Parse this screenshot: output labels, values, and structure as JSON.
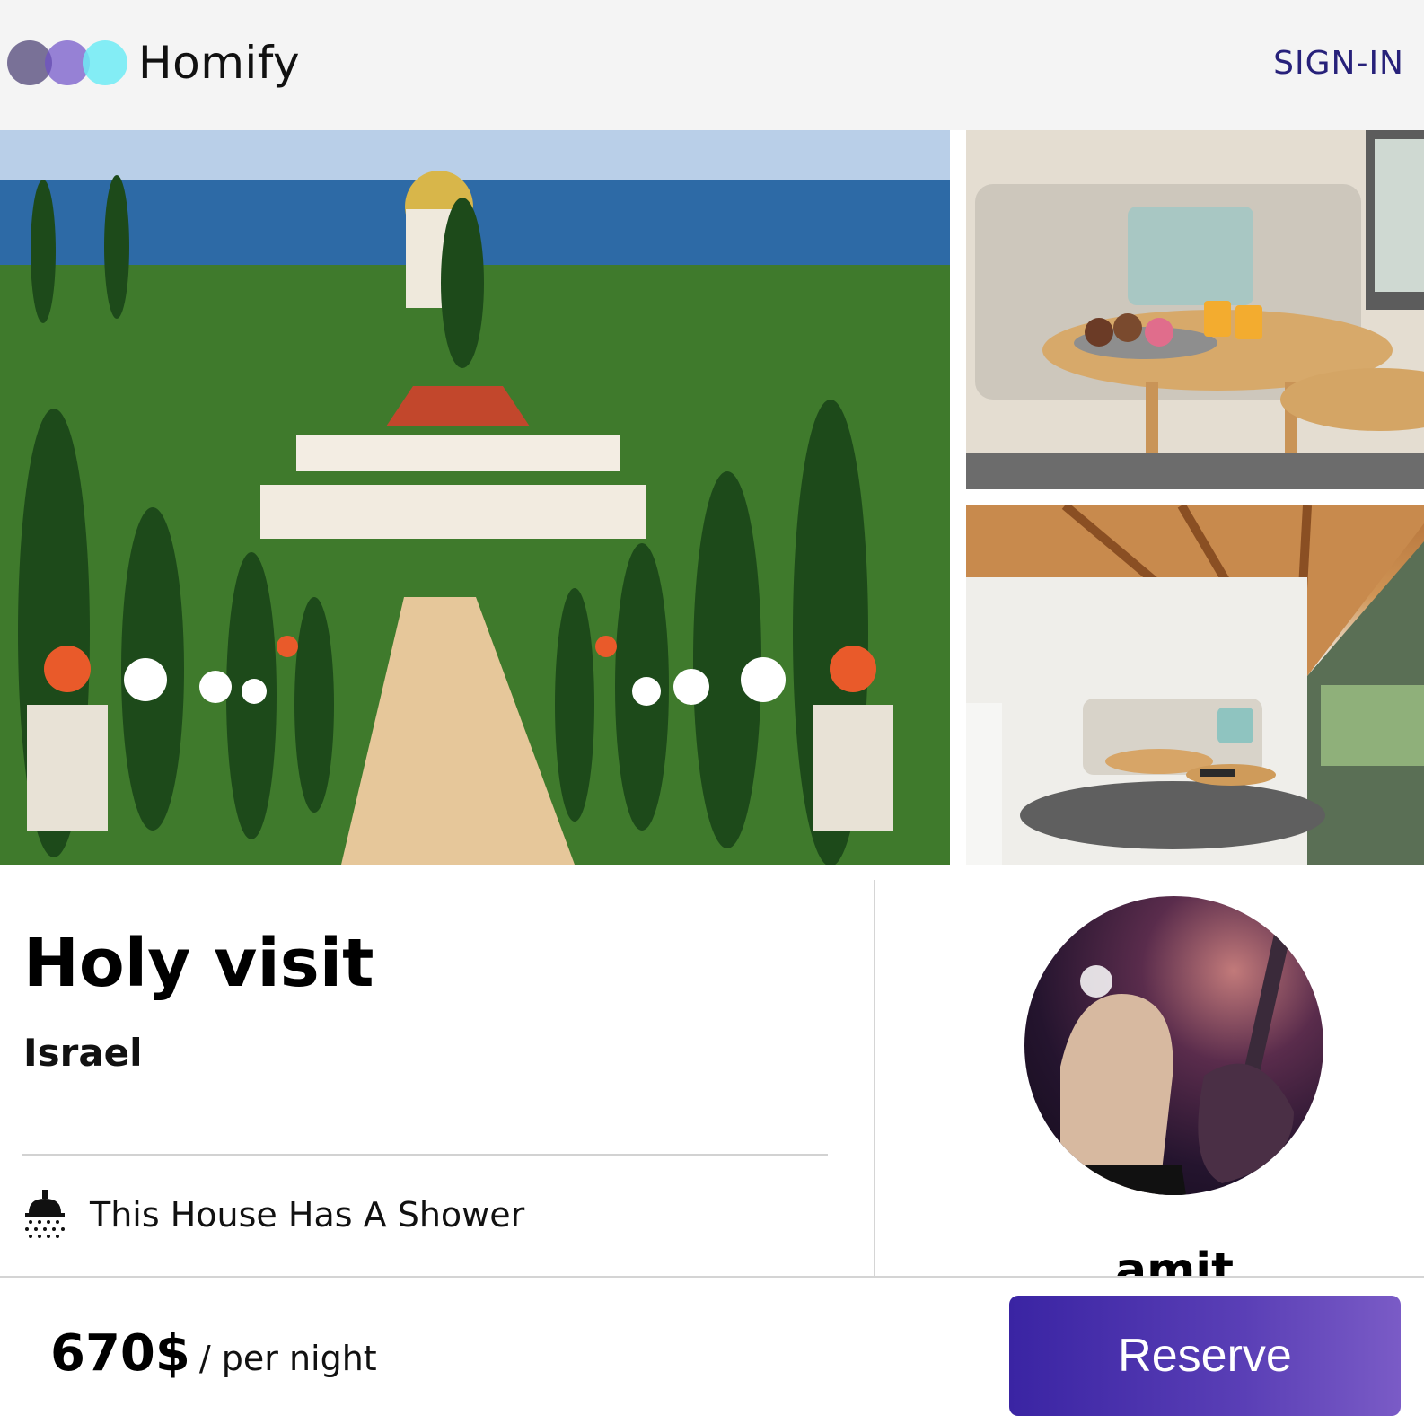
{
  "header": {
    "brand": "Homify",
    "signin_label": "SIGN-IN"
  },
  "gallery": {
    "images": [
      {
        "name": "main-photo",
        "alt": "Garden terraces overlooking the sea"
      },
      {
        "name": "living-room-photo",
        "alt": "Living room with sofa and round tables"
      },
      {
        "name": "attic-room-photo",
        "alt": "Attic room with wooden ceiling"
      }
    ]
  },
  "listing": {
    "title": "Holy visit",
    "country": "Israel",
    "amenities": [
      {
        "icon": "shower-icon",
        "label": "This House Has A Shower"
      }
    ]
  },
  "host": {
    "name": "amit"
  },
  "footer": {
    "price": "670$",
    "price_unit": "/ per night",
    "reserve_label": "Reserve"
  },
  "colors": {
    "accent": "#3a24a3",
    "signin": "#27217a",
    "header_bg": "#f4f4f4"
  }
}
